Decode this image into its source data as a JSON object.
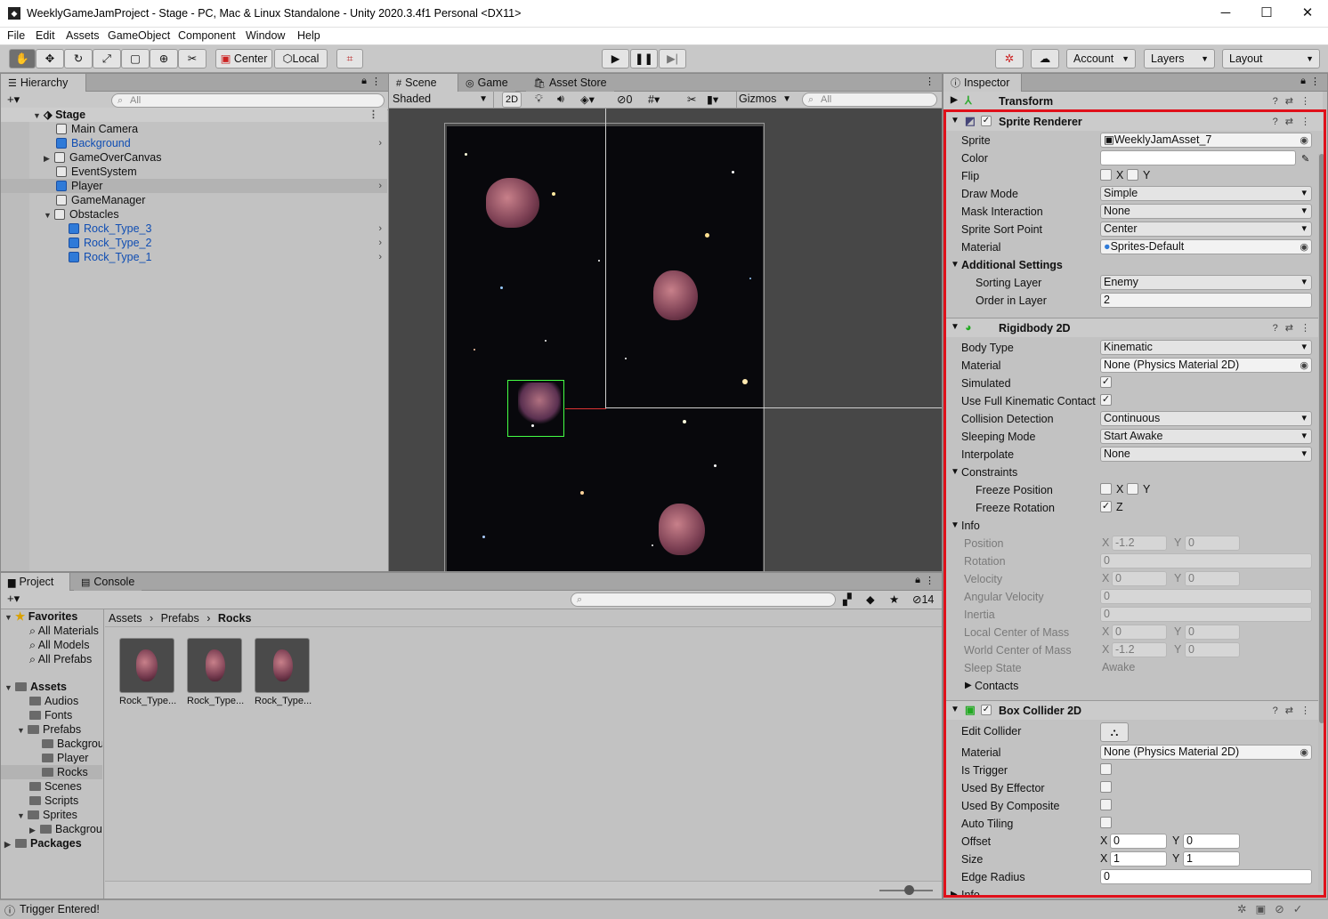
{
  "window": {
    "title": "WeeklyGameJamProject - Stage - PC, Mac & Linux Standalone - Unity 2020.3.4f1 Personal <DX11>",
    "minimize": "─",
    "maximize": "☐",
    "close": "✕"
  },
  "menu": [
    "File",
    "Edit",
    "Assets",
    "GameObject",
    "Component",
    "Window",
    "Help"
  ],
  "toolbar": {
    "pivot": "Center",
    "space": "Local",
    "account": "Account",
    "layers": "Layers",
    "layout": "Layout"
  },
  "hierarchy": {
    "tab": "Hierarchy",
    "search_placeholder": "All",
    "scene": "Stage",
    "items": [
      {
        "label": "Main Camera",
        "prefab": false
      },
      {
        "label": "Background",
        "prefab": true
      },
      {
        "label": "GameOverCanvas",
        "prefab": false
      },
      {
        "label": "EventSystem",
        "prefab": false
      },
      {
        "label": "Player",
        "prefab": true
      },
      {
        "label": "GameManager",
        "prefab": false
      },
      {
        "label": "Obstacles",
        "prefab": false
      },
      {
        "label": "Rock_Type_3",
        "prefab": true
      },
      {
        "label": "Rock_Type_2",
        "prefab": true
      },
      {
        "label": "Rock_Type_1",
        "prefab": true
      }
    ]
  },
  "scene_view": {
    "tabs": [
      "Scene",
      "Game",
      "Asset Store"
    ],
    "shading": "Shaded",
    "mode_2d": "2D",
    "hidden_count": "0",
    "gizmos": "Gizmos",
    "search_placeholder": "All"
  },
  "project": {
    "tabs": [
      "Project",
      "Console"
    ],
    "hidden_count": "14",
    "favorites_label": "Favorites",
    "favorites": [
      "All Materials",
      "All Models",
      "All Prefabs"
    ],
    "assets_label": "Assets",
    "folders": [
      "Audios",
      "Fonts",
      "Prefabs",
      "Backgrou",
      "Player",
      "Rocks",
      "Scenes",
      "Scripts",
      "Sprites",
      "Backgrou"
    ],
    "packages_label": "Packages",
    "breadcrumb": [
      "Assets",
      "Prefabs",
      "Rocks"
    ],
    "assets": [
      "Rock_Type...",
      "Rock_Type...",
      "Rock_Type..."
    ]
  },
  "inspector": {
    "tab": "Inspector",
    "transform": "Transform",
    "sprite_renderer": {
      "title": "Sprite Renderer",
      "rows": {
        "sprite": [
          "Sprite",
          "WeeklyJamAsset_7"
        ],
        "color": [
          "Color",
          ""
        ],
        "flip": [
          "Flip",
          "X",
          "Y"
        ],
        "draw_mode": [
          "Draw Mode",
          "Simple"
        ],
        "mask": [
          "Mask Interaction",
          "None"
        ],
        "sort_point": [
          "Sprite Sort Point",
          "Center"
        ],
        "material": [
          "Material",
          "Sprites-Default"
        ],
        "additional": [
          "Additional Settings"
        ],
        "sorting_layer": [
          "Sorting Layer",
          "Enemy"
        ],
        "order": [
          "Order in Layer",
          "2"
        ]
      }
    },
    "rigidbody": {
      "title": "Rigidbody 2D",
      "rows": {
        "body_type": [
          "Body Type",
          "Kinematic"
        ],
        "material": [
          "Material",
          "None (Physics Material 2D)"
        ],
        "simulated": [
          "Simulated"
        ],
        "full_contact": [
          "Use Full Kinematic Contact"
        ],
        "collision": [
          "Collision Detection",
          "Continuous"
        ],
        "sleeping": [
          "Sleeping Mode",
          "Start Awake"
        ],
        "interpolate": [
          "Interpolate",
          "None"
        ],
        "constraints": [
          "Constraints"
        ],
        "freeze_pos": [
          "Freeze Position",
          "X",
          "Y"
        ],
        "freeze_rot": [
          "Freeze Rotation",
          "Z"
        ],
        "info": [
          "Info"
        ],
        "position": [
          "Position",
          "X",
          "-1.2",
          "Y",
          "0"
        ],
        "rotation": [
          "Rotation",
          "0"
        ],
        "velocity": [
          "Velocity",
          "X",
          "0",
          "Y",
          "0"
        ],
        "ang_vel": [
          "Angular Velocity",
          "0"
        ],
        "inertia": [
          "Inertia",
          "0"
        ],
        "local_com": [
          "Local Center of Mass",
          "X",
          "0",
          "Y",
          "0"
        ],
        "world_com": [
          "World Center of Mass",
          "X",
          "-1.2",
          "Y",
          "0"
        ],
        "sleep_state": [
          "Sleep State",
          "Awake"
        ],
        "contacts": [
          "Contacts"
        ]
      }
    },
    "box_collider": {
      "title": "Box Collider 2D",
      "rows": {
        "edit": [
          "Edit Collider"
        ],
        "material": [
          "Material",
          "None (Physics Material 2D)"
        ],
        "trigger": [
          "Is Trigger"
        ],
        "effector": [
          "Used By Effector"
        ],
        "composite": [
          "Used By Composite"
        ],
        "tiling": [
          "Auto Tiling"
        ],
        "offset": [
          "Offset",
          "X",
          "0",
          "Y",
          "0"
        ],
        "size": [
          "Size",
          "X",
          "1",
          "Y",
          "1"
        ],
        "radius": [
          "Edge Radius",
          "0"
        ],
        "info": [
          "Info"
        ]
      }
    }
  },
  "status": {
    "message": "Trigger Entered!"
  },
  "colors": {
    "highlight_border": "#e0101a",
    "prefab_blue": "#0f4db3"
  }
}
